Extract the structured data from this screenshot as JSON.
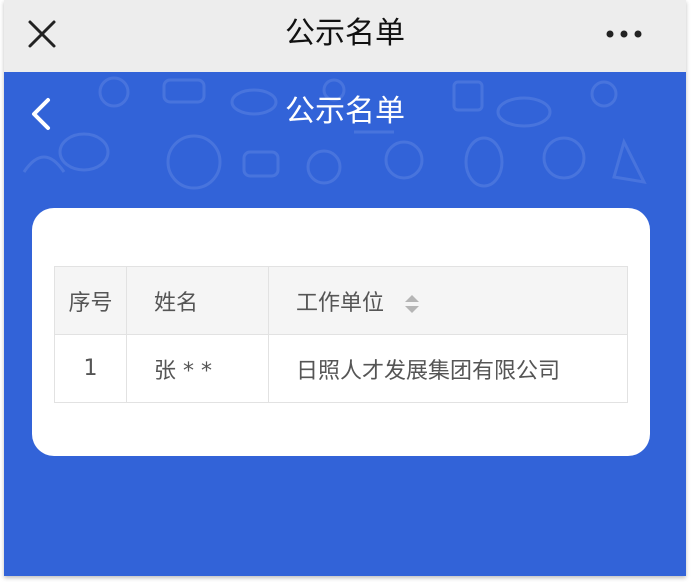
{
  "topbar": {
    "title": "公示名单"
  },
  "header": {
    "title": "公示名单"
  },
  "table": {
    "columns": [
      "序号",
      "姓名",
      "工作单位"
    ],
    "rows": [
      {
        "index": "1",
        "name": "张 * *",
        "unit": "日照人才发展集团有限公司"
      }
    ]
  },
  "colors": {
    "brand_blue": "#3263d8",
    "topbar_bg": "#ededed"
  },
  "icons": {
    "close": "close-icon",
    "more": "more-icon",
    "back": "chevron-left-icon",
    "sort": "sort-icon"
  }
}
